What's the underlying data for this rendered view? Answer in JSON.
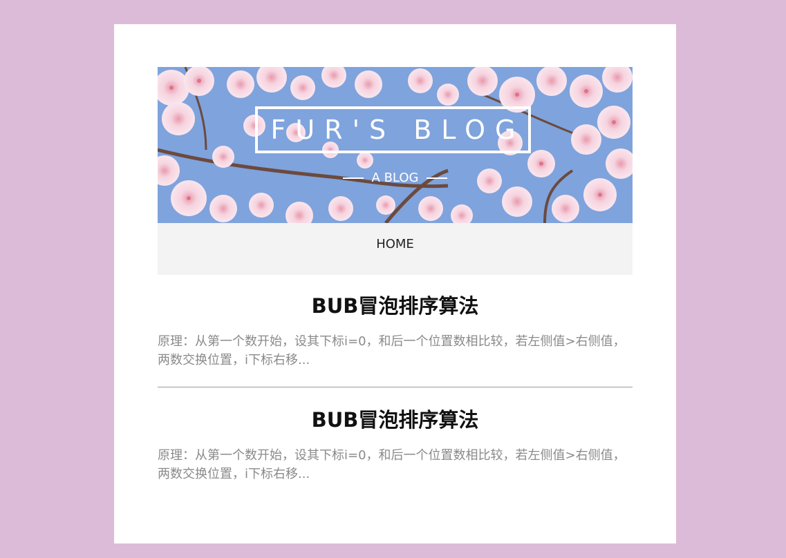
{
  "header": {
    "title": "FUR'S BLOG",
    "subtitle": "A BLOG"
  },
  "nav": {
    "items": [
      {
        "label": "HOME"
      }
    ]
  },
  "posts": [
    {
      "title": "BUB冒泡排序算法",
      "excerpt": "原理：从第一个数开始，设其下标i=0，和后一个位置数相比较，若左侧值>右侧值，两数交换位置，i下标右移..."
    },
    {
      "title": "BUB冒泡排序算法",
      "excerpt": "原理：从第一个数开始，设其下标i=0，和后一个位置数相比较，若左侧值>右侧值，两数交换位置，i下标右移..."
    }
  ],
  "colors": {
    "background": "#dcbbd9",
    "card": "#ffffff",
    "nav_background": "#f3f3f3",
    "sky": "#7fa3dc",
    "blossom": "#f3c9d8"
  }
}
